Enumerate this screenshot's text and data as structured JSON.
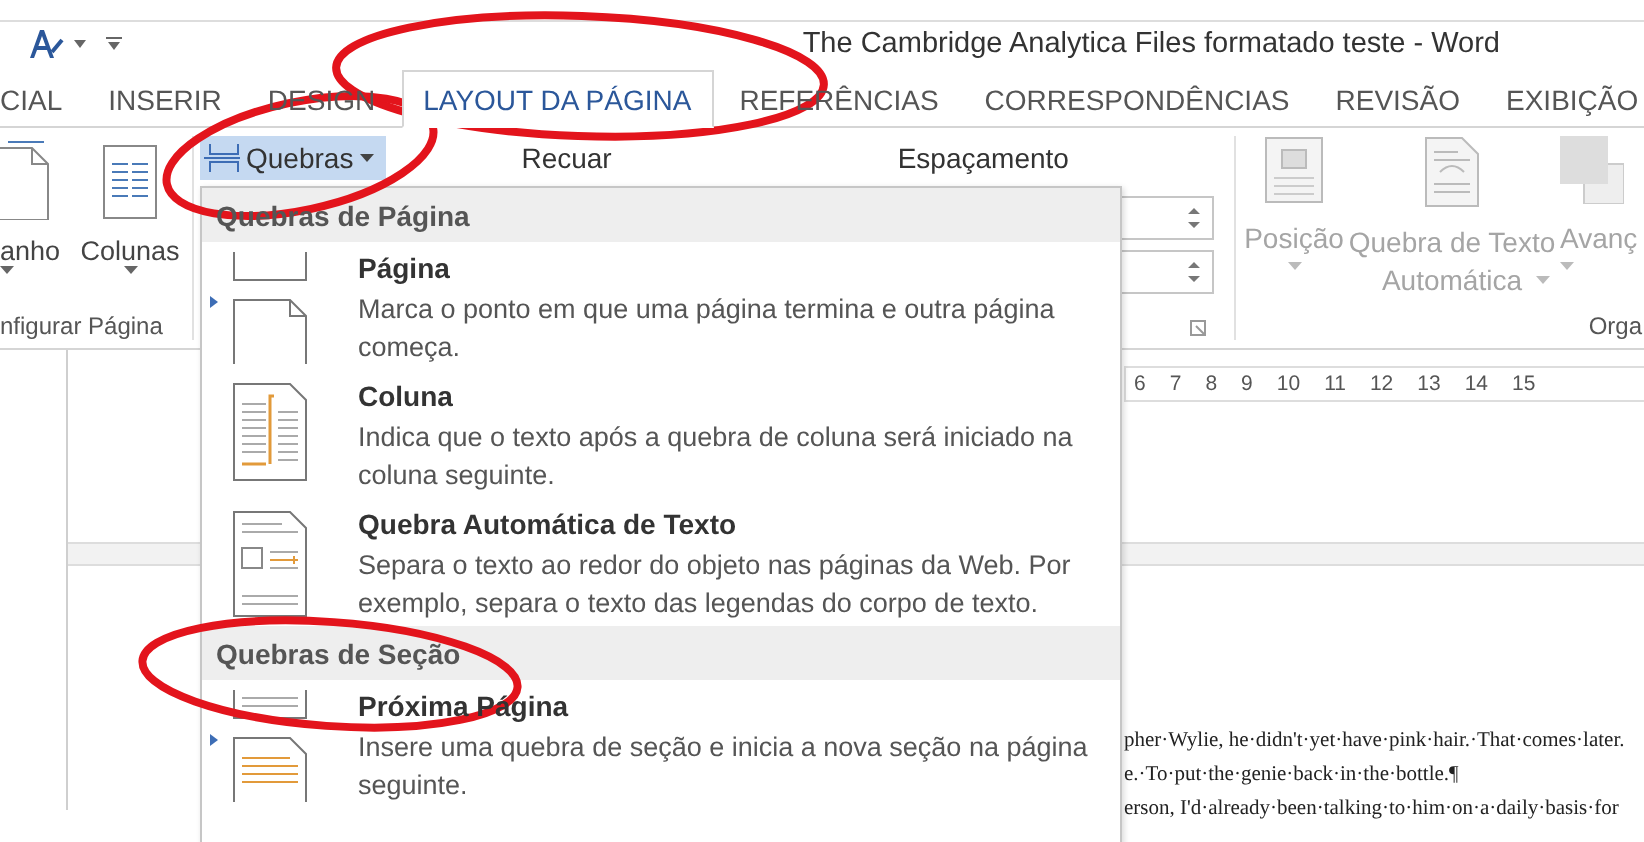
{
  "window": {
    "title": "The Cambridge Analytica Files formatado teste - Word"
  },
  "tabs": [
    {
      "label": "CIAL",
      "selected": false
    },
    {
      "label": "INSERIR",
      "selected": false
    },
    {
      "label": "DESIGN",
      "selected": false
    },
    {
      "label": "LAYOUT DA PÁGINA",
      "selected": true
    },
    {
      "label": "REFERÊNCIAS",
      "selected": false
    },
    {
      "label": "CORRESPONDÊNCIAS",
      "selected": false
    },
    {
      "label": "REVISÃO",
      "selected": false
    },
    {
      "label": "EXIBIÇÃO",
      "selected": false
    }
  ],
  "ribbon": {
    "page_setup": {
      "buttons": [
        {
          "kind": "size",
          "label": "anho"
        },
        {
          "kind": "columns",
          "label": "Colunas"
        }
      ],
      "group_label": "nfigurar Página"
    },
    "paragraph": {
      "breaks_button": {
        "label": "Quebras",
        "expanded": true
      },
      "indent_label": "Recuar",
      "spacing_label": "Espaçamento"
    },
    "arrange": {
      "buttons": [
        {
          "kind": "position",
          "label": "Posição"
        },
        {
          "kind": "wrap",
          "label": "Quebra de Texto Automática"
        },
        {
          "kind": "forward",
          "label": "Avanç"
        }
      ],
      "group_label": "Orga"
    }
  },
  "breaks_menu": {
    "sections": [
      {
        "header": "Quebras de Página",
        "items": [
          {
            "kind": "page",
            "title": "Página",
            "description": "Marca o ponto em que uma página termina e outra página começa."
          },
          {
            "kind": "column",
            "title": "Coluna",
            "description": "Indica que o texto após a quebra de coluna será iniciado na coluna seguinte."
          },
          {
            "kind": "text-wrap",
            "title": "Quebra Automática de Texto",
            "description": "Separa o texto ao redor do objeto nas páginas da Web. Por exemplo, separa o texto das legendas do corpo de texto."
          }
        ]
      },
      {
        "header": "Quebras de Seção",
        "items": [
          {
            "kind": "next-page",
            "title": "Próxima Página",
            "description": "Insere uma quebra de seção e inicia a nova seção na página seguinte."
          }
        ]
      }
    ]
  },
  "ruler": {
    "marks": [
      "6",
      "7",
      "8",
      "9",
      "10",
      "11",
      "12",
      "13",
      "14",
      "15"
    ]
  },
  "document": {
    "lines": [
      "pher·Wylie, he·didn't·yet·have·pink·hair.·That·comes·later.",
      "e.·To·put·the·genie·back·in·the·bottle.¶",
      "erson, I'd·already·been·talking·to·him·on·a·daily·basis·for"
    ]
  }
}
